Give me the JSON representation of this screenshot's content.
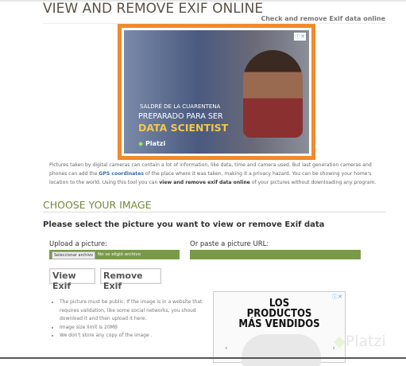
{
  "header": {
    "title": "VIEW AND REMOVE EXIF ONLINE",
    "subtitle": "Check and remove Exif data online"
  },
  "ad_top": {
    "line1": "SALDRÉ DE LA CUARENTENA",
    "line2": "PREPARADO PARA SER",
    "line3": "DATA SCIENTIST",
    "brand": "Platzi",
    "close": "ⓘ✕",
    "border_color": "#f08a2c"
  },
  "intro": {
    "part1": "Pictures taken by digital cameras can contain a lot of information, like data, time and camera used. But last generation cameras and phones can add the ",
    "link": "GPS coordinates",
    "part2": " of the place where it was taken, making it a privacy hazard. You can be showing your home's location to the world. Using this tool you can ",
    "bold": "view and remove exif data online",
    "part3": " of your pictures without downloading any program."
  },
  "section": {
    "title": "CHOOSE YOUR IMAGE",
    "prompt": "Please select the picture you want to view or remove Exif data"
  },
  "form": {
    "upload_label": "Upload a picture:",
    "file_button": "Seleccionar archivo",
    "file_status": "No se eligió archivo",
    "url_label": "Or paste a picture URL:",
    "url_value": "",
    "view_button": "View Exif",
    "remove_button": "Remove Exif",
    "accent": "#7a9a4a"
  },
  "notes": [
    "The picture must be public. If the image is in a website that requires validation, like some social networks, you shoud download it and then upload it here.",
    "Image size limit is 20MB",
    "We don't store any copy of the image ."
  ],
  "ad_side": {
    "line1": "LOS",
    "line2": "PRODUCTOS",
    "line3": "MÁS VENDIDOS",
    "close": "ⓘ✕",
    "prev": "‹",
    "next": "›"
  },
  "watermark": "Platzi"
}
